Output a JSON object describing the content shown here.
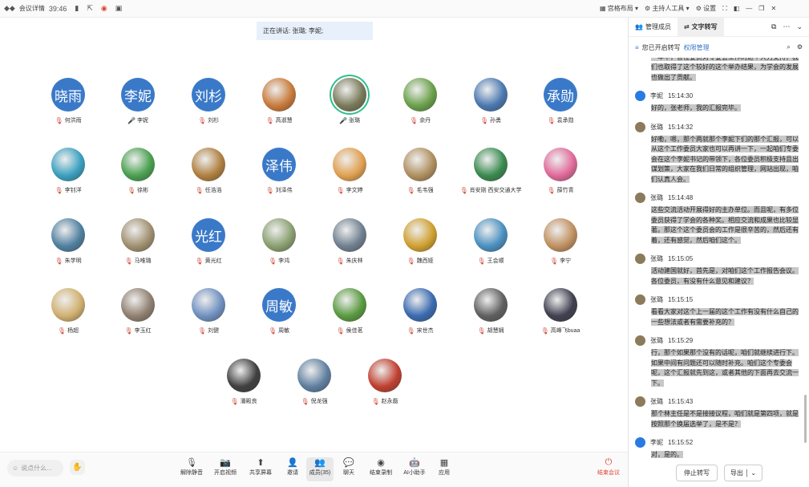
{
  "topbar": {
    "app": "会议详情",
    "timer": "39:46",
    "layout_label": "宫格布局",
    "tools_label": "主持人工具",
    "settings_label": "设置"
  },
  "speaking": "正在讲话: 张璐; 李妮;",
  "participants": [
    {
      "name": "何洪雨",
      "avatar": "晓雨",
      "color": "#3a79c8",
      "mic": "muted"
    },
    {
      "name": "李妮",
      "avatar": "李妮",
      "color": "#3a79c8",
      "mic": "on"
    },
    {
      "name": "刘杉",
      "avatar": "刘杉",
      "color": "#3a79c8",
      "mic": "muted"
    },
    {
      "name": "高淑慧",
      "avatar": "",
      "color": "#c87a3a",
      "mic": "muted"
    },
    {
      "name": "张璐",
      "avatar": "",
      "color": "#7a7a5a",
      "mic": "on"
    },
    {
      "name": "余丹",
      "avatar": "",
      "color": "#6aa04a",
      "mic": "muted"
    },
    {
      "name": "孙勇",
      "avatar": "",
      "color": "#4a78b0",
      "mic": "muted"
    },
    {
      "name": "袁承勋",
      "avatar": "承勋",
      "color": "#3a79c8",
      "mic": "muted"
    },
    {
      "name": "李钊洋",
      "avatar": "",
      "color": "#3aa0c0",
      "mic": "muted"
    },
    {
      "name": "徐彬",
      "avatar": "",
      "color": "#4aa050",
      "mic": "muted"
    },
    {
      "name": "任浩浩",
      "avatar": "",
      "color": "#b08040",
      "mic": "muted"
    },
    {
      "name": "刘泽伟",
      "avatar": "泽伟",
      "color": "#3a79c8",
      "mic": "muted"
    },
    {
      "name": "李文婷",
      "avatar": "",
      "color": "#e0a050",
      "mic": "muted"
    },
    {
      "name": "毛韦强",
      "avatar": "",
      "color": "#b09060",
      "mic": "muted"
    },
    {
      "name": "肖安刚 西安交通大学",
      "avatar": "",
      "color": "#3a8a50",
      "mic": "muted"
    },
    {
      "name": "薛竹青",
      "avatar": "",
      "color": "#e06a9a",
      "mic": "muted"
    },
    {
      "name": "朱学明",
      "avatar": "",
      "color": "#5080a0",
      "mic": "muted"
    },
    {
      "name": "马唯璐",
      "avatar": "",
      "color": "#a09070",
      "mic": "muted"
    },
    {
      "name": "黄光红",
      "avatar": "光红",
      "color": "#3a79c8",
      "mic": "muted"
    },
    {
      "name": "李鸿",
      "avatar": "",
      "color": "#8aa070",
      "mic": "muted"
    },
    {
      "name": "朱庆林",
      "avatar": "",
      "color": "#708090",
      "mic": "muted"
    },
    {
      "name": "魏西娅",
      "avatar": "",
      "color": "#d0a030",
      "mic": "muted"
    },
    {
      "name": "王会顺",
      "avatar": "",
      "color": "#4a90c0",
      "mic": "muted"
    },
    {
      "name": "李宁",
      "avatar": "",
      "color": "#c09060",
      "mic": "muted"
    },
    {
      "name": "杨超",
      "avatar": "",
      "color": "#d0b070",
      "mic": "muted"
    },
    {
      "name": "李玉红",
      "avatar": "",
      "color": "#908070",
      "mic": "muted"
    },
    {
      "name": "刘健",
      "avatar": "",
      "color": "#7090c0",
      "mic": "muted"
    },
    {
      "name": "周敏",
      "avatar": "周敏",
      "color": "#3a79c8",
      "mic": "muted"
    },
    {
      "name": "侯佳茗",
      "avatar": "",
      "color": "#5a9a40",
      "mic": "muted"
    },
    {
      "name": "宋世杰",
      "avatar": "",
      "color": "#3a6ab0",
      "mic": "muted"
    },
    {
      "name": "胡慧娴",
      "avatar": "",
      "color": "#606060",
      "mic": "muted"
    },
    {
      "name": "高峰飞buaa",
      "avatar": "",
      "color": "#404050",
      "mic": "muted"
    },
    {
      "name": "潘殿良",
      "avatar": "",
      "color": "#404040",
      "mic": "muted"
    },
    {
      "name": "倪龙强",
      "avatar": "",
      "color": "#6080a0",
      "mic": "muted"
    },
    {
      "name": "赵永磊",
      "avatar": "",
      "color": "#c04030",
      "mic": "muted"
    }
  ],
  "bottom": {
    "input_placeholder": "说点什么...",
    "buttons": [
      "解除静音",
      "开启视频",
      "共享屏幕",
      "邀请",
      "成员(35)",
      "聊天",
      "结束录制",
      "AI小助手",
      "应用",
      "结束会议"
    ]
  },
  "side": {
    "tab1": "管理成员",
    "tab2": "文字转写",
    "notice": "您已开启转写",
    "link": "权限管理",
    "entries": [
      {
        "speaker": "",
        "time": "",
        "text": "那以前的这个队伍，都有参加过。那么那么在过去的一年中，各位委员对专委会工作的这个大力支持，我们也取得了这个较好的这个举办结果，为学会的发展也做出了贡献。",
        "blue": false
      },
      {
        "speaker": "李妮",
        "time": "15:14:30",
        "text": "好的，张老师，我的汇报完毕。",
        "blue": true
      },
      {
        "speaker": "张璐",
        "time": "15:14:32",
        "text": "好嘞，嗯，那个两就那个李妮下们的那个汇报，可以从这个工作委员大家也可以再讲一下，一起咱们专委会在这个李妮书记的带领下，各位委员积极支持且出谋划策，大家在我们日常的组织管理，网站出现，咱们认真人会。",
        "blue": false
      },
      {
        "speaker": "张璐",
        "time": "15:14:48",
        "text": "这些交流活动开展得好的主办单位。而且呢，有多位委员获得了学会的各种奖。相应交流和成果也比较显著。那这个这个委员会的工作是很辛苦的，然后还有着，还有感觉，然后咱们这个。",
        "blue": false
      },
      {
        "speaker": "张璐",
        "time": "15:15:05",
        "text": "活动建国就好，首先是，对咱们这个工作报告会议。各位委员，有没有什么意见和建议？",
        "blue": false
      },
      {
        "speaker": "张璐",
        "time": "15:15:15",
        "text": "看看大家对这个上一届的这个工作有没有什么自己的一些想法或者有需要补充的？",
        "blue": false
      },
      {
        "speaker": "张璐",
        "time": "15:15:29",
        "text": "行，那个如果那个没有的话呢，咱们就继续进行下。如果中间有问题还可以随时补充。咱们这个专委会呢，这个汇报就先到这，或者其他的下面再去交流一下。",
        "blue": false
      },
      {
        "speaker": "张璐",
        "time": "15:15:43",
        "text": "那个林主任是不是接接议程，咱们就是第四项，就是按照那个换届选举了，是不是？",
        "blue": false
      },
      {
        "speaker": "李妮",
        "time": "15:15:52",
        "text": "对，是的。",
        "blue": true
      }
    ],
    "stop_label": "停止转写",
    "export_label": "导出"
  }
}
